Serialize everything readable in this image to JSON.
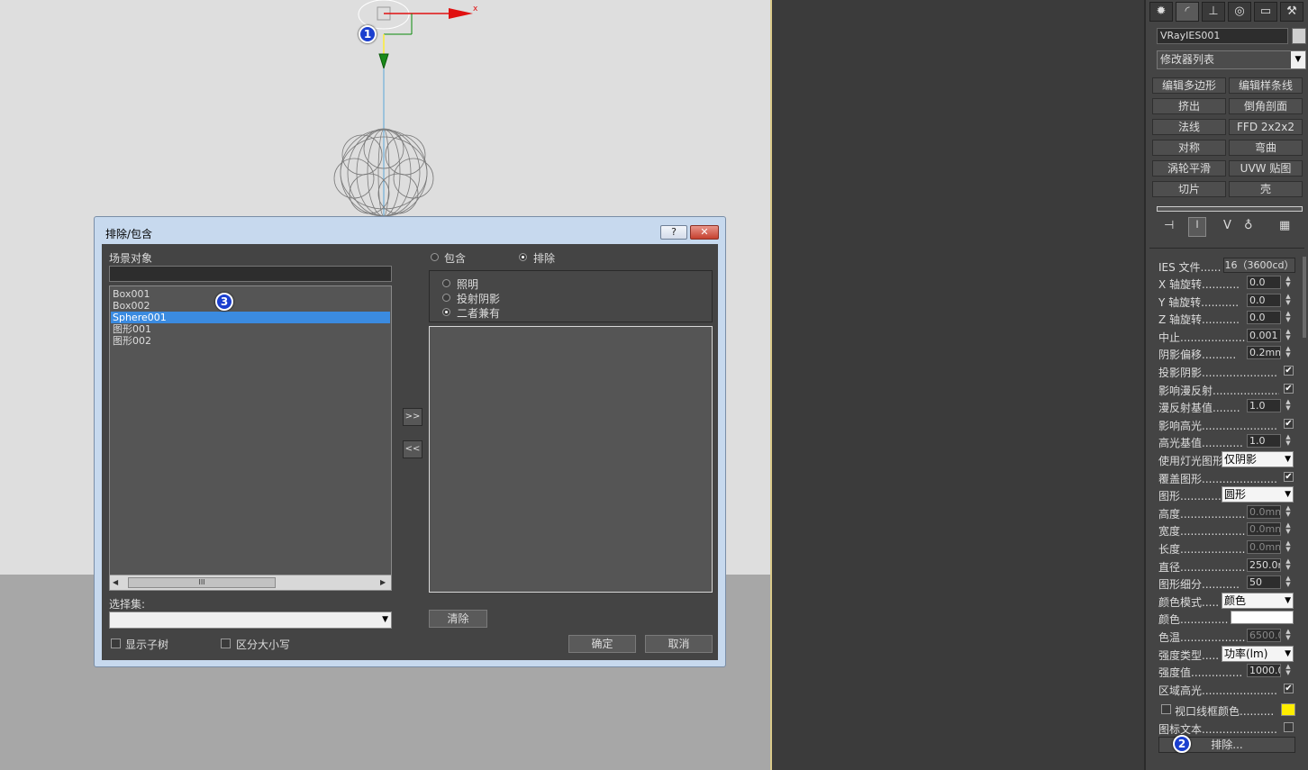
{
  "viewport": {
    "axis_x_label": "x",
    "badge1": "1"
  },
  "dialog": {
    "title": "排除/包含",
    "help_label": "?",
    "close_label": "✕",
    "scene_objects_label": "场景对象",
    "scene_filter_value": "",
    "scene_objects": [
      {
        "name": "Box001",
        "selected": false
      },
      {
        "name": "Box002",
        "selected": false
      },
      {
        "name": "Sphere001",
        "selected": true
      },
      {
        "name": "图形001",
        "selected": false
      },
      {
        "name": "图形002",
        "selected": false
      }
    ],
    "badge3": "3",
    "scroll_grip": "III",
    "mode_include": "包含",
    "mode_exclude": "排除",
    "mode_selected": "排除",
    "effect_options": [
      {
        "label": "照明",
        "selected": false
      },
      {
        "label": "投射阴影",
        "selected": false
      },
      {
        "label": "二者兼有",
        "selected": true
      }
    ],
    "move_right": ">>",
    "move_left": "<<",
    "selection_set_label": "选择集:",
    "selection_set_value": "",
    "clear_label": "清除",
    "show_subtree_label": "显示子树",
    "case_sensitive_label": "区分大小写",
    "ok_label": "确定",
    "cancel_label": "取消"
  },
  "panel": {
    "tabs": [
      "create-icon",
      "modify-icon",
      "hierarchy-icon",
      "motion-icon",
      "display-icon",
      "utilities-icon"
    ],
    "object_name": "VRayIES001",
    "modifier_list": "修改器列表",
    "modifier_buttons": [
      [
        "编辑多边形",
        "编辑样条线"
      ],
      [
        "挤出",
        "倒角剖面"
      ],
      [
        "法线",
        "FFD 2x2x2"
      ],
      [
        "对称",
        "弯曲"
      ],
      [
        "涡轮平滑",
        "UVW 贴图"
      ],
      [
        "切片",
        "壳"
      ]
    ],
    "ies_file_label": "IES 文件......",
    "ies_file_value": "16（3600cd）",
    "rows": [
      {
        "label": "X 轴旋转...........",
        "type": "spin",
        "value": "0.0"
      },
      {
        "label": "Y 轴旋转...........",
        "type": "spin",
        "value": "0.0"
      },
      {
        "label": "Z 轴旋转...........",
        "type": "spin",
        "value": "0.0"
      },
      {
        "label": "中止...................",
        "type": "spin",
        "value": "0.001"
      },
      {
        "label": "阴影偏移..........",
        "type": "spin",
        "value": "0.2mm"
      },
      {
        "label": "投影阴影......................",
        "type": "check",
        "value": "✔"
      },
      {
        "label": "影响漫反射......................",
        "type": "check",
        "value": "✔"
      },
      {
        "label": "漫反射基值........",
        "type": "spin",
        "value": "1.0"
      },
      {
        "label": "影响高光......................",
        "type": "check",
        "value": "✔"
      },
      {
        "label": "高光基值............",
        "type": "spin",
        "value": "1.0"
      },
      {
        "label": "使用灯光图形",
        "type": "select",
        "value": "仅阴影"
      },
      {
        "label": "覆盖图形......................",
        "type": "check",
        "value": "✔"
      },
      {
        "label": "图形............",
        "type": "select",
        "value": "圆形"
      },
      {
        "label": "高度...................",
        "type": "spin-dim",
        "value": "0.0mm"
      },
      {
        "label": "宽度...................",
        "type": "spin-dim",
        "value": "0.0mm"
      },
      {
        "label": "长度...................",
        "type": "spin-dim",
        "value": "0.0mm"
      },
      {
        "label": "直径...................",
        "type": "spin",
        "value": "250.0m"
      },
      {
        "label": "图形细分...........",
        "type": "spin",
        "value": "50"
      },
      {
        "label": "颜色模式.....",
        "type": "select",
        "value": "颜色"
      },
      {
        "label": "颜色..............",
        "type": "color",
        "value": "#ffffff"
      },
      {
        "label": "色温...................",
        "type": "spin-dim",
        "value": "6500.0"
      },
      {
        "label": "强度类型.....",
        "type": "select",
        "value": "功率(lm)"
      },
      {
        "label": "强度值...............",
        "type": "spin",
        "value": "1000.0"
      },
      {
        "label": "区域高光......................",
        "type": "check",
        "value": "✔"
      }
    ],
    "viewport_wire_label": "视口线框颜色..........",
    "viewport_wire_color": "#ffee00",
    "icon_text_label": "图标文本......................",
    "exclude_button": "排除...",
    "badge2": "2"
  },
  "colors": {
    "accent_selection": "#3b8be0",
    "badge": "#1b3fcf",
    "gizmo_red": "#e01010",
    "gizmo_green": "#0a8a0a"
  }
}
